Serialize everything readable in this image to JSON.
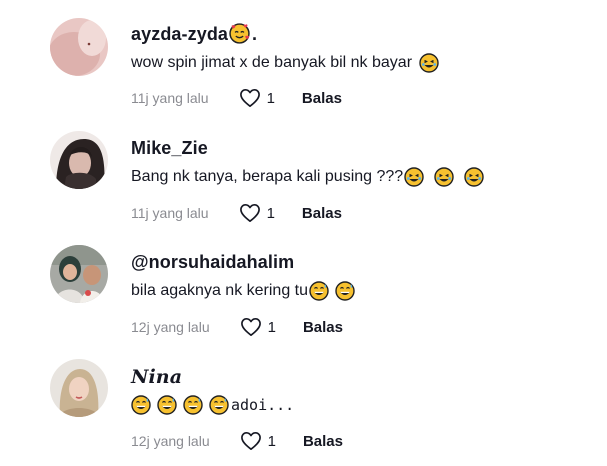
{
  "comments": [
    {
      "username": "ayzda-zyda",
      "username_suffix": ".",
      "username_emoji": "smiling-hearts-emoji",
      "text": "wow spin jimat x de banyak bil nk bayar",
      "text_emoji_after": [
        "rofl-emoji"
      ],
      "time": "11j yang lalu",
      "likes": "1",
      "reply_label": "Balas"
    },
    {
      "username": "Mike_Zie",
      "text": "Bang nk tanya, berapa kali pusing ???",
      "text_emoji_after": [
        "rofl-emoji",
        "rofl-emoji",
        "rofl-emoji"
      ],
      "time": "11j yang lalu",
      "likes": "1",
      "reply_label": "Balas"
    },
    {
      "username": "@norsuhaidahalim",
      "text": "bila agaknya nk kering tu",
      "text_emoji_after": [
        "grinning-sweat-emoji",
        "grinning-sweat-emoji"
      ],
      "time": "12j yang lalu",
      "likes": "1",
      "reply_label": "Balas"
    },
    {
      "username": "Nina",
      "text_emoji_before": [
        "grinning-sweat-emoji",
        "grinning-sweat-emoji",
        "grinning-sweat-emoji",
        "grinning-sweat-emoji"
      ],
      "text": "adoi...",
      "time": "12j yang lalu",
      "likes": "1",
      "reply_label": "Balas"
    }
  ],
  "colors": {
    "primary_text": "#161823",
    "secondary_text": "#8a8b91",
    "emoji_yellow": "#f7c12f"
  }
}
